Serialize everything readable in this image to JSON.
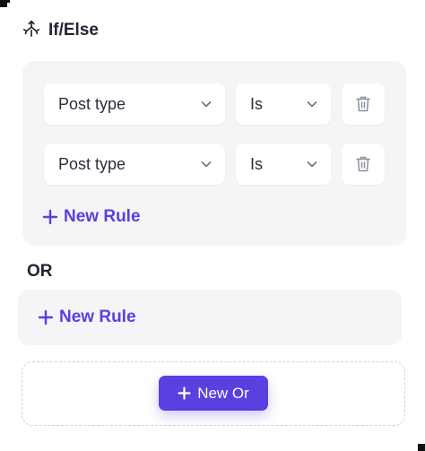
{
  "header": {
    "title": "If/Else",
    "icon": "branch-icon"
  },
  "group1": {
    "rules": [
      {
        "field": "Post type",
        "operator": "Is"
      },
      {
        "field": "Post type",
        "operator": "Is"
      }
    ],
    "new_rule_label": "New Rule"
  },
  "or_label": "OR",
  "group2": {
    "new_rule_label": "New Rule"
  },
  "new_or_label": "New Or",
  "colors": {
    "accent": "#5b3fe0",
    "panel_bg": "#f4f5f7",
    "text": "#1f2433",
    "dashed_border": "#cfd3da"
  }
}
